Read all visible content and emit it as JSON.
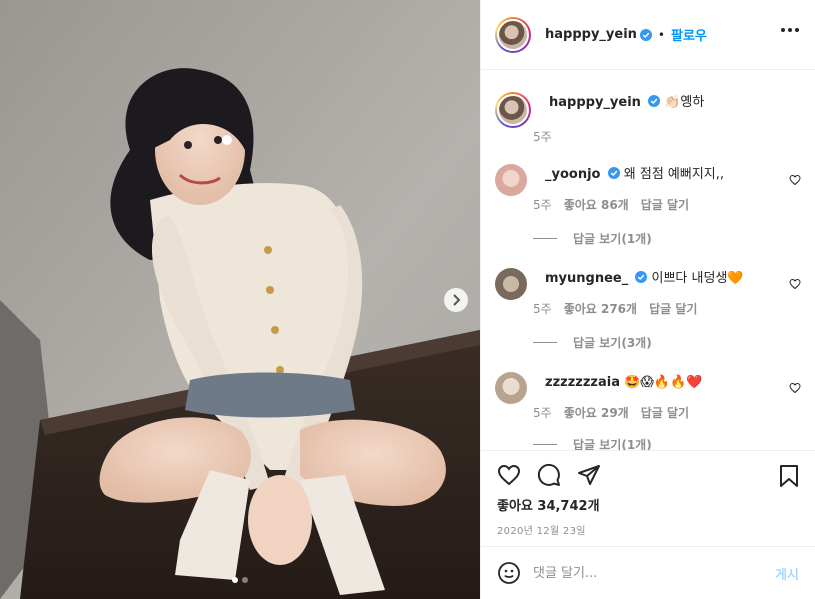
{
  "header": {
    "username": "happpy_yein",
    "separator": "•",
    "follow_label": "팔로우"
  },
  "caption": {
    "username": "happpy_yein",
    "text": "👏🏻옝하",
    "time": "5주"
  },
  "comments": [
    {
      "username": "_yoonjo",
      "verified": true,
      "text": "왜 점점 예뻐지지,,",
      "time": "5주",
      "likes": "좋아요 86개",
      "reply_label": "답글 달기",
      "view_replies": "답글 보기(1개)"
    },
    {
      "username": "myungnee_",
      "verified": true,
      "text": "이쁘다 내덩생🧡",
      "time": "5주",
      "likes": "좋아요 276개",
      "reply_label": "답글 달기",
      "view_replies": "답글 보기(3개)"
    },
    {
      "username": "zzzzzzzaia",
      "verified": false,
      "text": "🤩😱🔥🔥❤️",
      "time": "5주",
      "likes": "좋아요 29개",
      "reply_label": "답글 달기",
      "view_replies": "답글 보기(1개)"
    }
  ],
  "actions": {
    "likes_text": "좋아요 34,742개",
    "date": "2020년 12월 23일"
  },
  "add_comment": {
    "placeholder": "댓글 달기...",
    "post_label": "게시"
  },
  "carousel": {
    "total": 2,
    "current": 1
  },
  "colors": {
    "link_blue": "#0095f6",
    "verified_blue": "#3897f0",
    "muted": "#8e8e8e",
    "border": "#efefef",
    "text": "#262626"
  },
  "icons": [
    "heart-icon",
    "comment-icon",
    "share-icon",
    "bookmark-icon",
    "chevron-right-icon",
    "verified-icon",
    "more-icon",
    "emoji-icon"
  ]
}
